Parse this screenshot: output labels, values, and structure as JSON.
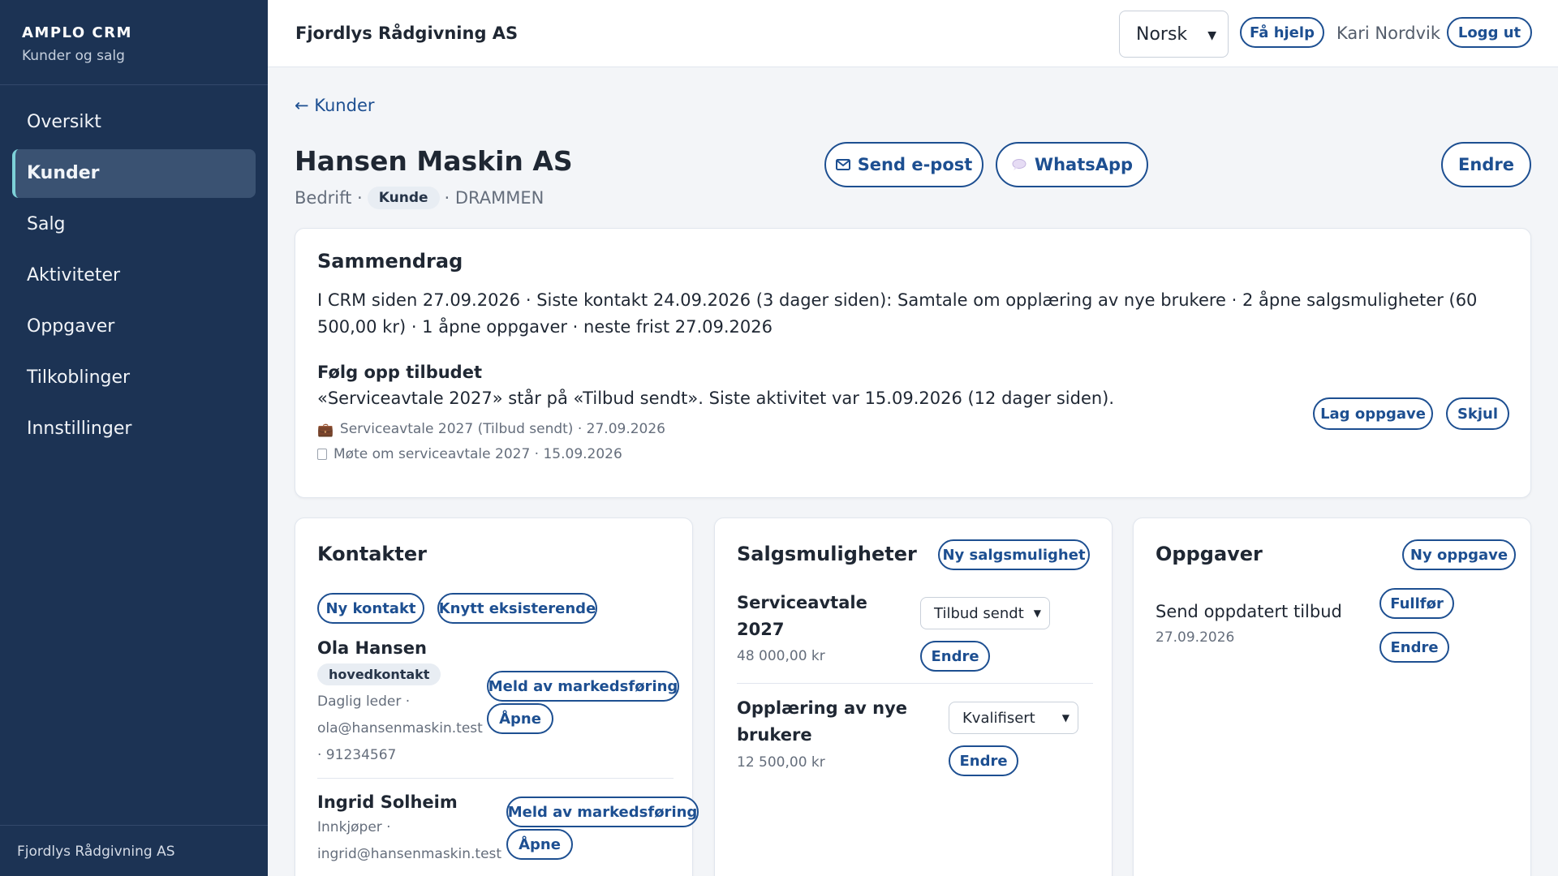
{
  "sidebar": {
    "brand_title": "AMPLO CRM",
    "brand_sub": "Kunder og salg",
    "items": [
      {
        "label": "Oversikt",
        "active": false
      },
      {
        "label": "Kunder",
        "active": true
      },
      {
        "label": "Salg",
        "active": false
      },
      {
        "label": "Aktiviteter",
        "active": false
      },
      {
        "label": "Oppgaver",
        "active": false
      },
      {
        "label": "Tilkoblinger",
        "active": false
      },
      {
        "label": "Innstillinger",
        "active": false
      }
    ],
    "footer": "Fjordlys Rådgivning AS"
  },
  "header": {
    "company": "Fjordlys Rådgivning AS",
    "language": "Norsk",
    "help_label": "Få hjelp",
    "user_name": "Kari Nordvik",
    "logout_label": "Logg ut"
  },
  "customer": {
    "back_label": "← Kunder",
    "name": "Hansen Maskin AS",
    "type": "Bedrift ·",
    "status_tag": "Kunde",
    "city": "· DRAMMEN",
    "email_label": "Send e-post",
    "whatsapp_label": "WhatsApp",
    "edit_label": "Endre"
  },
  "summary": {
    "title": "Sammendrag",
    "text": "I CRM siden 27.09.2026 · Siste kontakt 24.09.2026 (3 dager siden): Samtale om opplæring av nye brukere · 2 åpne salgsmuligheter (60 500,00 kr) · 1 åpne oppgaver · neste frist 27.09.2026",
    "followup_title": "Følg opp tilbudet",
    "followup_text": "«Serviceavtale 2027» står på «Tilbud sendt». Siste aktivitet var 15.09.2026 (12 dager siden).",
    "related_opportunity": "Serviceavtale 2027 (Tilbud sendt) · 27.09.2026",
    "related_meeting": "Møte om serviceavtale 2027 · 15.09.2026",
    "create_task_label": "Lag oppgave",
    "hide_label": "Skjul"
  },
  "contacts": {
    "title": "Kontakter",
    "new_label": "Ny kontakt",
    "link_label": "Knytt eksisterende",
    "unsubscribe_label": "Meld av markedsføring",
    "open_label": "Åpne",
    "items": [
      {
        "name": "Ola Hansen",
        "badge": "hovedkontakt",
        "line1": "Daglig leder ·",
        "line2": "ola@hansenmaskin.test",
        "line3": "· 91234567"
      },
      {
        "name": "Ingrid Solheim",
        "line1": "Innkjøper ·",
        "line2": "ingrid@hansenmaskin.test"
      }
    ]
  },
  "opportunities": {
    "title": "Salgsmuligheter",
    "new_label": "Ny salgsmulighet",
    "edit_label": "Endre",
    "items": [
      {
        "title_l1": "Serviceavtale",
        "title_l2": "2027",
        "amount": "48 000,00 kr",
        "stage": "Tilbud sendt"
      },
      {
        "title_l1": "Opplæring av nye",
        "title_l2": "brukere",
        "amount": "12 500,00 kr",
        "stage": "Kvalifisert"
      }
    ]
  },
  "tasks": {
    "title": "Oppgaver",
    "new_label": "Ny oppgave",
    "complete_label": "Fullfør",
    "edit_label": "Endre",
    "items": [
      {
        "title": "Send oppdatert tilbud",
        "date": "27.09.2026"
      }
    ]
  }
}
